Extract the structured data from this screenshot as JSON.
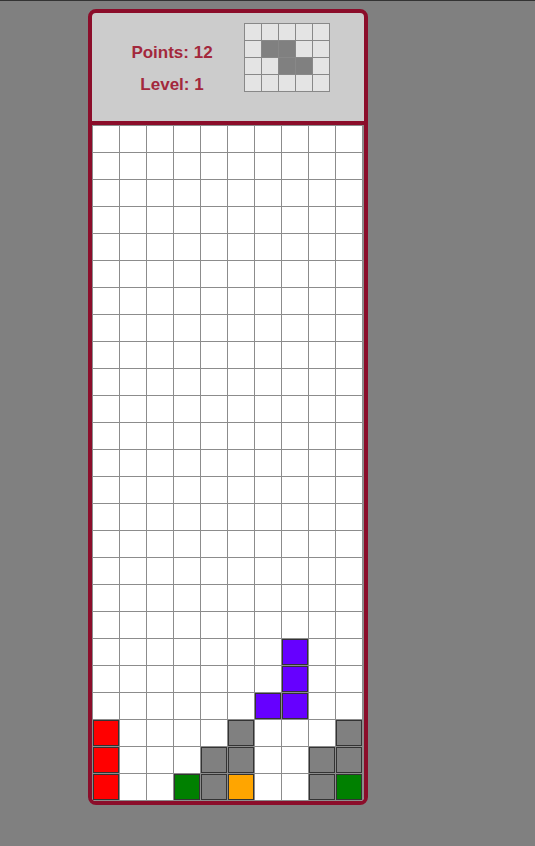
{
  "stats": {
    "points": "Points: 12",
    "level": "Level: 1"
  },
  "next_piece": {
    "cells": [
      [
        false,
        false,
        false,
        false,
        false
      ],
      [
        false,
        true,
        true,
        false,
        false
      ],
      [
        false,
        false,
        true,
        true,
        false
      ],
      [
        false,
        false,
        false,
        false,
        false
      ]
    ],
    "color": "#808080"
  },
  "board": {
    "rows": [
      [
        null,
        null,
        null,
        null,
        null,
        null,
        null,
        null,
        null,
        null
      ],
      [
        null,
        null,
        null,
        null,
        null,
        null,
        null,
        null,
        null,
        null
      ],
      [
        null,
        null,
        null,
        null,
        null,
        null,
        null,
        null,
        null,
        null
      ],
      [
        null,
        null,
        null,
        null,
        null,
        null,
        null,
        null,
        null,
        null
      ],
      [
        null,
        null,
        null,
        null,
        null,
        null,
        null,
        null,
        null,
        null
      ],
      [
        null,
        null,
        null,
        null,
        null,
        null,
        null,
        null,
        null,
        null
      ],
      [
        null,
        null,
        null,
        null,
        null,
        null,
        null,
        null,
        null,
        null
      ],
      [
        null,
        null,
        null,
        null,
        null,
        null,
        null,
        null,
        null,
        null
      ],
      [
        null,
        null,
        null,
        null,
        null,
        null,
        null,
        null,
        null,
        null
      ],
      [
        null,
        null,
        null,
        null,
        null,
        null,
        null,
        null,
        null,
        null
      ],
      [
        null,
        null,
        null,
        null,
        null,
        null,
        null,
        null,
        null,
        null
      ],
      [
        null,
        null,
        null,
        null,
        null,
        null,
        null,
        null,
        null,
        null
      ],
      [
        null,
        null,
        null,
        null,
        null,
        null,
        null,
        null,
        null,
        null
      ],
      [
        null,
        null,
        null,
        null,
        null,
        null,
        null,
        null,
        null,
        null
      ],
      [
        null,
        null,
        null,
        null,
        null,
        null,
        null,
        null,
        null,
        null
      ],
      [
        null,
        null,
        null,
        null,
        null,
        null,
        null,
        null,
        null,
        null
      ],
      [
        null,
        null,
        null,
        null,
        null,
        null,
        null,
        null,
        null,
        null
      ],
      [
        null,
        null,
        null,
        null,
        null,
        null,
        null,
        null,
        null,
        null
      ],
      [
        null,
        null,
        null,
        null,
        null,
        null,
        null,
        null,
        null,
        null
      ],
      [
        null,
        null,
        null,
        null,
        null,
        null,
        null,
        "#6600ff",
        null,
        null
      ],
      [
        null,
        null,
        null,
        null,
        null,
        null,
        null,
        "#6600ff",
        null,
        null
      ],
      [
        null,
        null,
        null,
        null,
        null,
        null,
        "#6600ff",
        "#6600ff",
        null,
        null
      ],
      [
        "#ff0000",
        null,
        null,
        null,
        null,
        "#808080",
        null,
        null,
        null,
        "#808080"
      ],
      [
        "#ff0000",
        null,
        null,
        null,
        "#808080",
        "#808080",
        null,
        null,
        "#808080",
        "#808080"
      ],
      [
        "#ff0000",
        null,
        null,
        "#008000",
        "#808080",
        "#ffa500",
        null,
        null,
        "#808080",
        "#008000"
      ]
    ]
  }
}
